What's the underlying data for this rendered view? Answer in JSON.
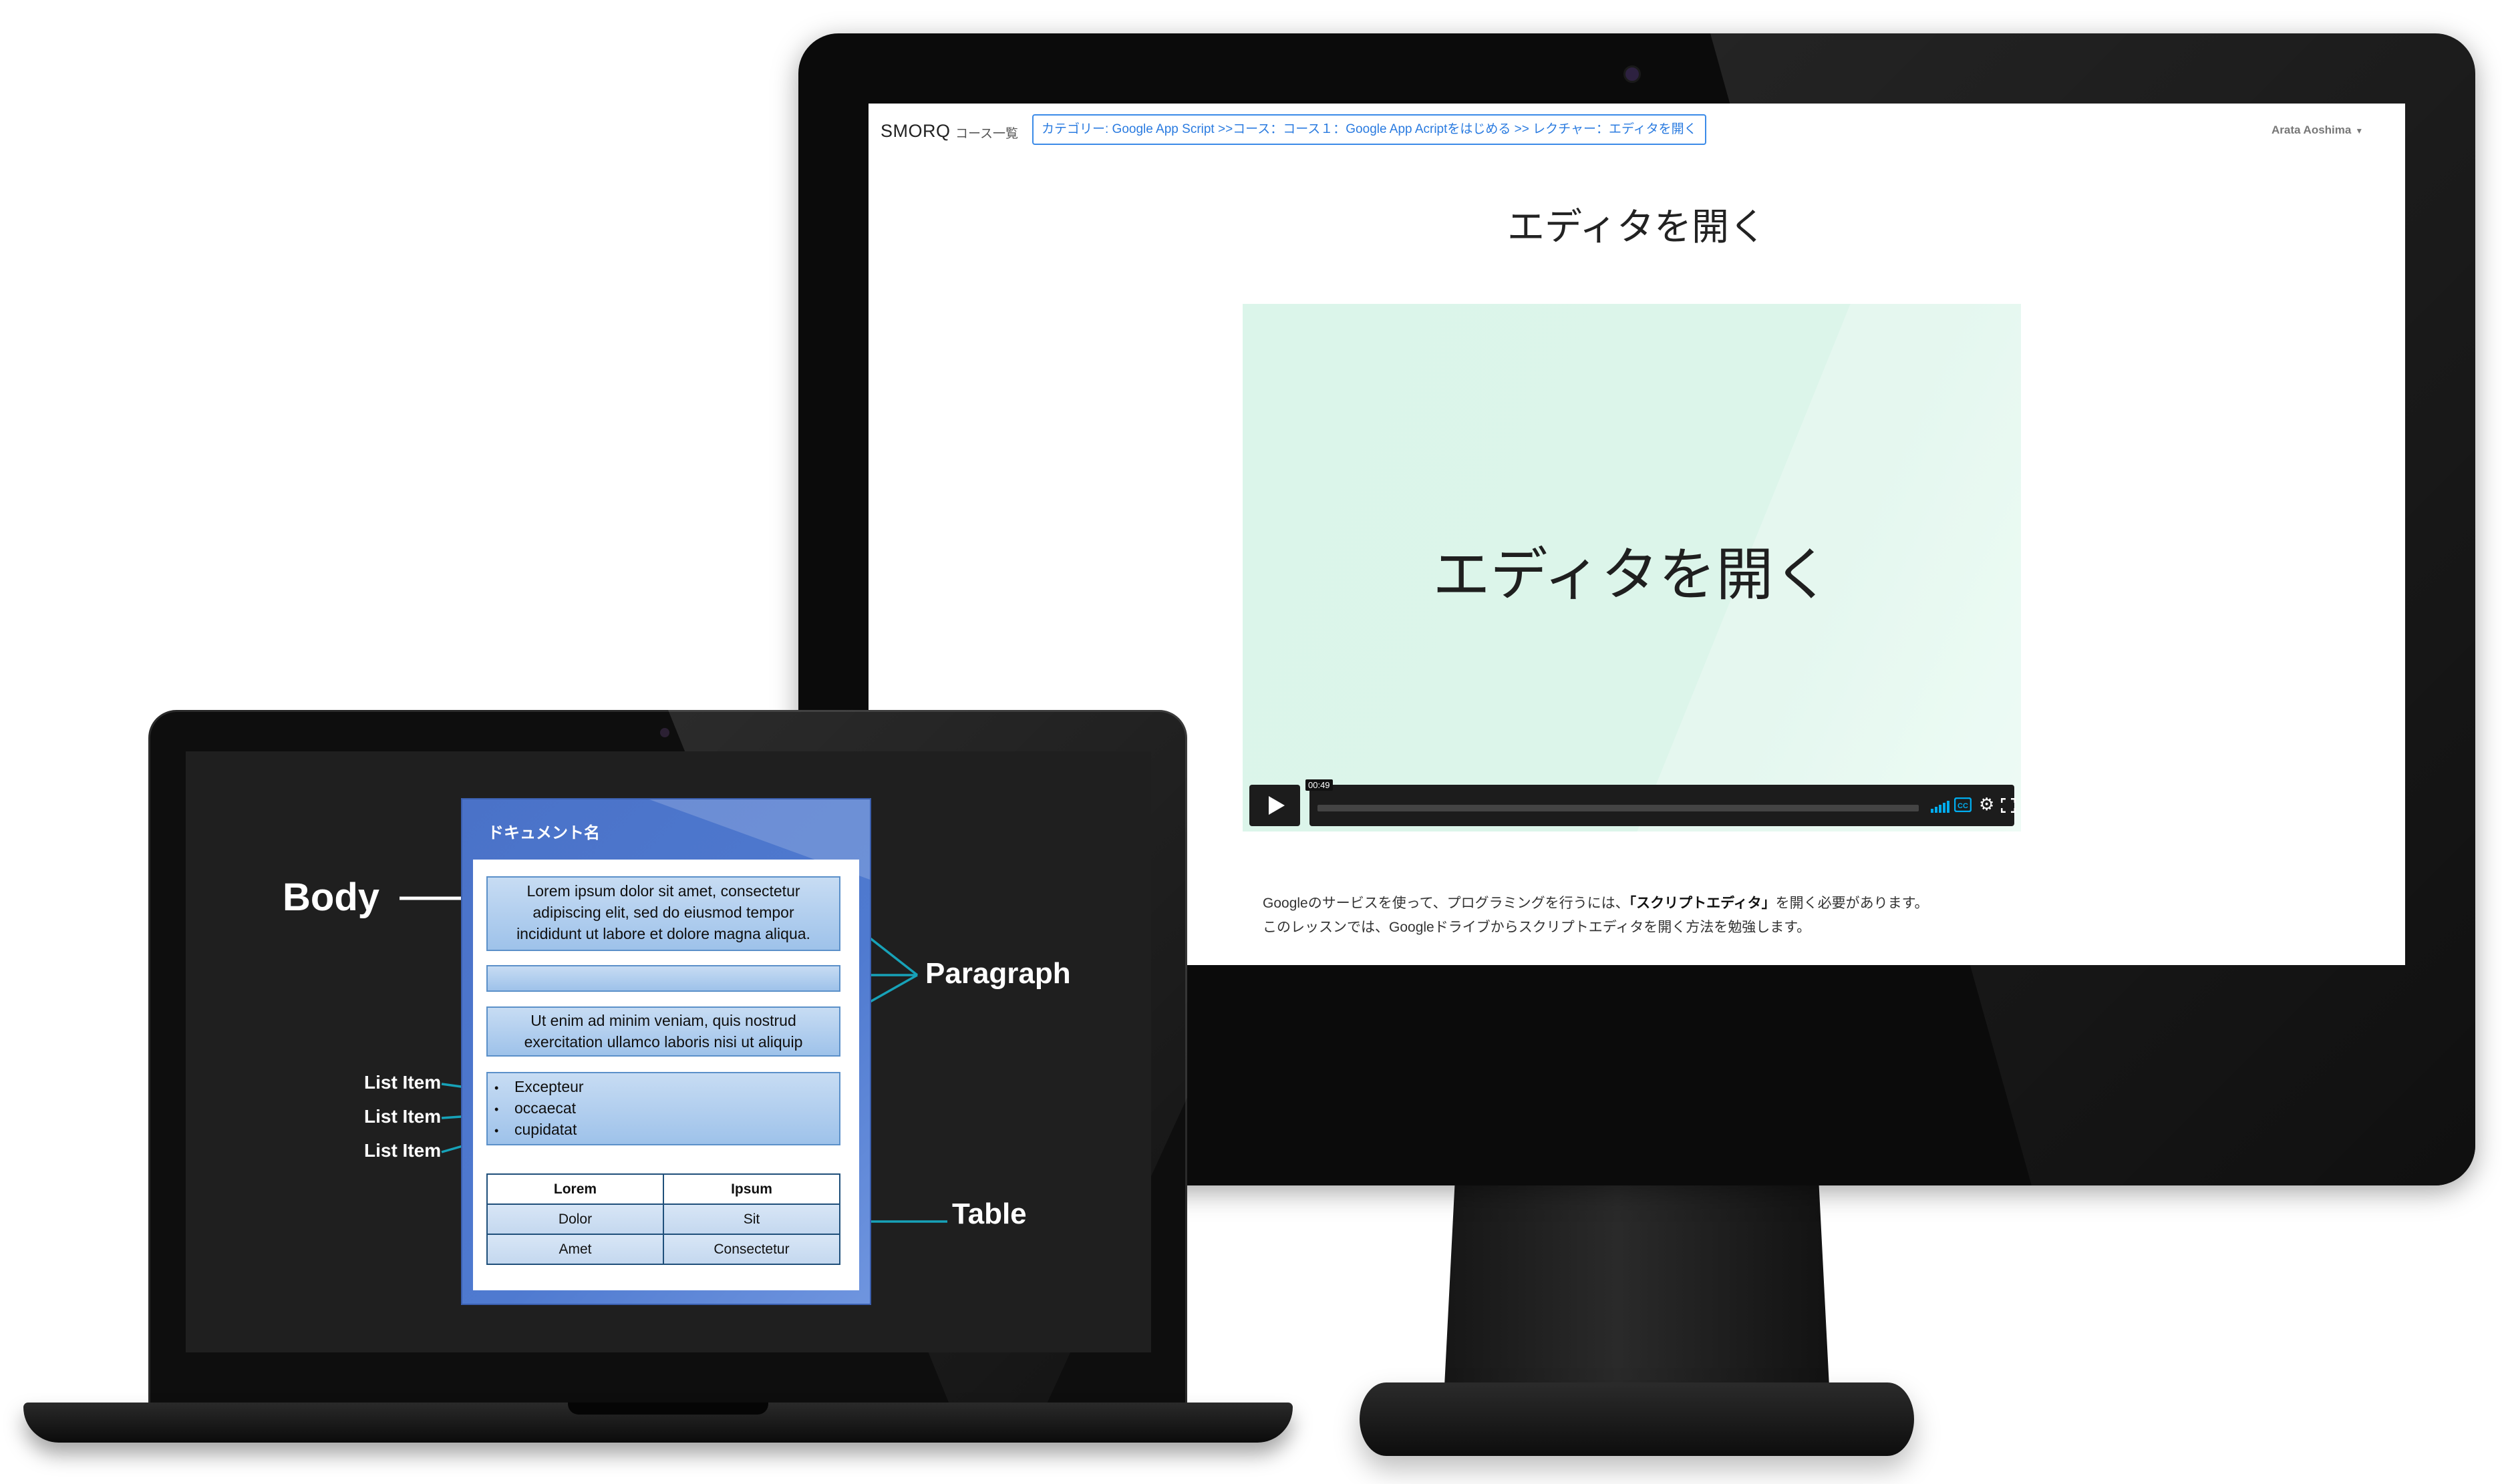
{
  "desktop_app": {
    "brand": "SMORQ",
    "nav_courses": "コース一覧",
    "breadcrumb": "カテゴリー: Google App Script >>コース：コース１：Google App Acriptをはじめる >> レクチャー：エディタを開く",
    "user_name": "Arata Aoshima",
    "user_caret_icon": "caret-down-icon",
    "lecture_title": "エディタを開く",
    "video": {
      "slide_title": "エディタを開く",
      "time": "00:49",
      "progress": 0.0,
      "controls": [
        "play-icon",
        "volume-icon",
        "cc-icon",
        "settings-icon",
        "fullscreen-icon"
      ],
      "controls_color": "#1c1c1c",
      "accent_color": "#00adef"
    },
    "description": {
      "line1_before": "Googleのサービスを使って、プログラミングを行うには、",
      "line1_bold": "「スクリプトエディタ」",
      "line1_after": "を開く必要があります。",
      "line2": "このレッスンでは、Googleドライブからスクリプトエディタを開く方法を勉強します。"
    }
  },
  "laptop_diagram": {
    "doc_title": "ドキュメント名",
    "paragraph_1": [
      "Lorem ipsum dolor sit amet, consectetur",
      "adipiscing elit, sed do eiusmod tempor",
      "incididunt ut labore et dolore magna aliqua."
    ],
    "paragraph_3": [
      "Ut enim ad minim veniam, quis nostrud",
      "exercitation ullamco laboris nisi ut aliquip"
    ],
    "list_items": [
      "Excepteur",
      "occaecat",
      "cupidatat"
    ],
    "table": {
      "header": [
        "Lorem",
        "Ipsum"
      ],
      "rows": [
        [
          "Dolor",
          "Sit"
        ],
        [
          "Amet",
          "Consectetur"
        ]
      ]
    },
    "labels": {
      "body": "Body",
      "paragraph": "Paragraph",
      "table": "Table",
      "list_item": "List Item"
    },
    "colors": {
      "panel": "#4f7ad0",
      "paragraph_fill": "#9ec2ea",
      "callout_line": "#17a2b8"
    }
  }
}
